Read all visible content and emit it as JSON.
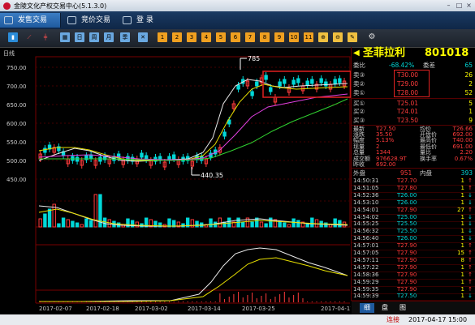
{
  "window": {
    "title": "金陵文化产权交易中心(5.1.3.0)"
  },
  "tabs": [
    {
      "label": "发售交易"
    },
    {
      "label": "竞价交易"
    },
    {
      "label": "登 录"
    }
  ],
  "toolbar": {
    "buttons": [
      "1",
      "2",
      "3",
      "4",
      "5",
      "6",
      "7",
      "8",
      "9",
      "10",
      "11"
    ]
  },
  "chart": {
    "period_label": "日线",
    "high_annotation": "785",
    "low_annotation": "440.35",
    "y_ticks": [
      "750.00",
      "700.00",
      "650.00",
      "600.00",
      "550.00",
      "500.00",
      "450.00"
    ],
    "x_ticks": [
      "2017-02-07",
      "2017-02-18",
      "2017-03-02",
      "2017-03-14",
      "2017-03-25",
      "2017-04-17"
    ]
  },
  "quote": {
    "name": "圣菲拉利",
    "code": "801018",
    "ratio_label": "委比",
    "ratio_value": "-68.42%",
    "diff_label": "委差",
    "diff_value": "65",
    "sell": [
      {
        "label": "卖③",
        "price": "T30.00",
        "vol": "26"
      },
      {
        "label": "卖②",
        "price": "T29.00",
        "vol": "2"
      },
      {
        "label": "卖①",
        "price": "T28.00",
        "vol": "52"
      }
    ],
    "buy": [
      {
        "label": "买①",
        "price": "T25.01",
        "vol": "5"
      },
      {
        "label": "买②",
        "price": "T24.01",
        "vol": "1"
      },
      {
        "label": "买③",
        "price": "T23.50",
        "vol": "9"
      }
    ],
    "stats": [
      {
        "l1": "最新",
        "v1": "T27.50",
        "l2": "均价",
        "v2": "T26.66"
      },
      {
        "l1": "涨跌",
        "v1": "35.50",
        "l2": "开盘价",
        "v2": "692.00"
      },
      {
        "l1": "幅度",
        "v1": "5.13%",
        "l2": "最高价",
        "v2": "T40.00"
      },
      {
        "l1": "现量",
        "v1": "2",
        "l2": "最低价",
        "v2": "691.00"
      },
      {
        "l1": "总量",
        "v1": "1344",
        "l2": "量比",
        "v2": "2.20"
      },
      {
        "l1": "成交额",
        "v1": "976628.9T",
        "l2": "换手率",
        "v2": "0.67%"
      },
      {
        "l1": "昨收",
        "v1": "692.00",
        "l2": "",
        "v2": ""
      }
    ],
    "outer_label": "外盘",
    "outer_value": "951",
    "inner_label": "内盘",
    "inner_value": "393",
    "ticks": [
      {
        "time": "14:50:31",
        "price": "T27.70",
        "vol": "1",
        "dir": "↑"
      },
      {
        "time": "14:51:05",
        "price": "T27.80",
        "vol": "1",
        "dir": "↑"
      },
      {
        "time": "14:52:36",
        "price": "T26.00",
        "vol": "1",
        "dir": "↓"
      },
      {
        "time": "14:53:10",
        "price": "T26.00",
        "vol": "1",
        "dir": "↓"
      },
      {
        "time": "14:54:01",
        "price": "T27.90",
        "vol": "27",
        "dir": "↑"
      },
      {
        "time": "14:54:02",
        "price": "T25.00",
        "vol": "1",
        "dir": "↓"
      },
      {
        "time": "14:55:25",
        "price": "T25.50",
        "vol": "1",
        "dir": "↓"
      },
      {
        "time": "14:56:32",
        "price": "T25.50",
        "vol": "1",
        "dir": "↓"
      },
      {
        "time": "14:56:40",
        "price": "T26.00",
        "vol": "1",
        "dir": "↓"
      },
      {
        "time": "14:57:01",
        "price": "T27.90",
        "vol": "1",
        "dir": "↑"
      },
      {
        "time": "14:57:05",
        "price": "T27.90",
        "vol": "15",
        "dir": "↑"
      },
      {
        "time": "14:57:11",
        "price": "T27.90",
        "vol": "8",
        "dir": "↑"
      },
      {
        "time": "14:57:22",
        "price": "T27.90",
        "vol": "1",
        "dir": "↑"
      },
      {
        "time": "14:58:36",
        "price": "T27.90",
        "vol": "1",
        "dir": "↑"
      },
      {
        "time": "14:59:29",
        "price": "T27.90",
        "vol": "1",
        "dir": "↑"
      },
      {
        "time": "14:59:35",
        "price": "T27.90",
        "vol": "1",
        "dir": "↑"
      },
      {
        "time": "14:59:39",
        "price": "T27.50",
        "vol": "1",
        "dir": "↓"
      }
    ]
  },
  "bottom_tabs": [
    "细",
    "盘",
    "图"
  ],
  "status": {
    "connection": "连接",
    "datetime": "2017-04-17 15:00"
  },
  "colors": {
    "up": "#ff3b3b",
    "down": "#00d8d8",
    "accent": "#ffff00",
    "bg": "#000000",
    "highlight": "#e02020"
  },
  "chart_data": {
    "type": "candlestick",
    "y_range": [
      430,
      790
    ],
    "x": [
      "2017-02-07",
      "2017-02-18",
      "2017-03-02",
      "2017-03-14",
      "2017-03-25",
      "2017-04-17"
    ],
    "high_marker": 785,
    "low_marker": 440.35
  }
}
